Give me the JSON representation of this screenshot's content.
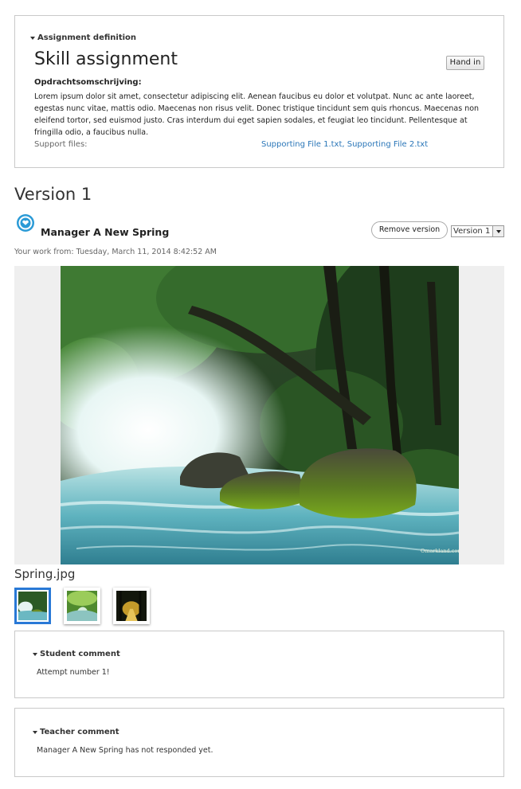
{
  "assignment": {
    "section_label": "Assignment definition",
    "title": "Skill assignment",
    "hand_in_label": "Hand in",
    "description_heading": "Opdrachtsomschrijving:",
    "description_body": "Lorem ipsum dolor sit amet, consectetur adipiscing elit. Aenean faucibus eu dolor et volutpat. Nunc ac ante laoreet, egestas nunc vitae, mattis odio. Maecenas non risus velit. Donec tristique tincidunt sem quis rhoncus. Maecenas non eleifend tortor, sed euismod justo. Cras interdum dui eget sapien sodales, et feugiat leo tincidunt. Pellentesque at fringilla odio, a faucibus nulla.",
    "support_files_label": "Support files:",
    "support_files": "Supporting File 1.txt, Supporting File 2.txt"
  },
  "version": {
    "title": "Version 1",
    "user_name": "Manager A New Spring",
    "remove_label": "Remove version",
    "selected_version": "Version 1",
    "work_from": "Your work from: Tuesday, March 11, 2014 8:42:52 AM",
    "file_name": "Spring.jpg",
    "watermark": "Omarkland.com"
  },
  "student_comment": {
    "label": "Student comment",
    "text": "Attempt number 1!"
  },
  "teacher_comment": {
    "label": "Teacher comment",
    "text": "Manager A New Spring has not responded yet."
  },
  "colors": {
    "link": "#2a76b8",
    "selected_thumb": "#2979d6",
    "avatar": "#2a9ad6"
  },
  "icons": {
    "caret": "caret-down-icon",
    "avatar": "user-avatar-icon",
    "select": "chevron-down-icon"
  }
}
